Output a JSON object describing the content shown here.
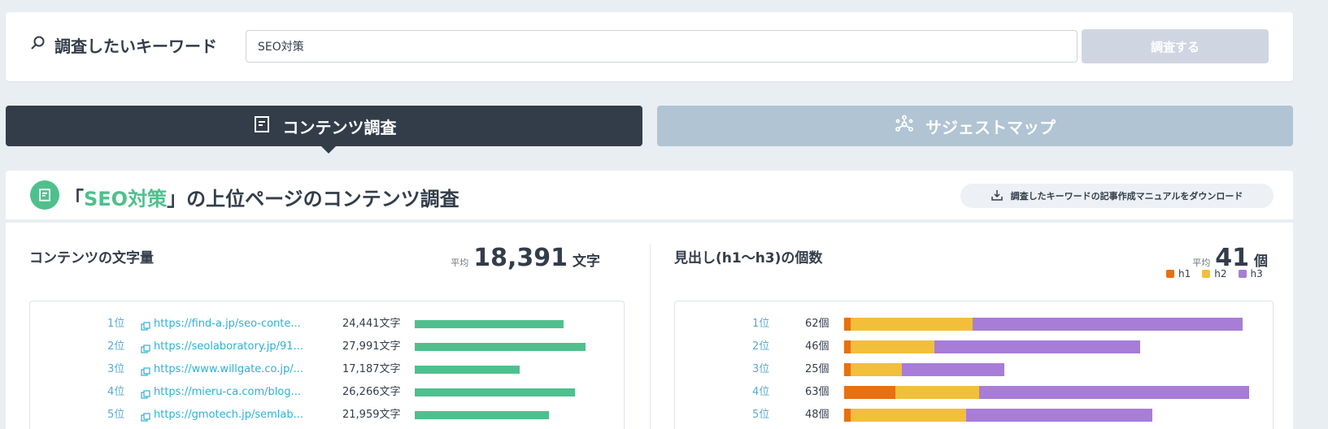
{
  "search": {
    "label": "調査したいキーワード",
    "value": "SEO対策",
    "button_label": "調査する"
  },
  "tabs": [
    {
      "label": "コンテンツ調査",
      "active": true
    },
    {
      "label": "サジェストマップ",
      "active": false
    }
  ],
  "main": {
    "title_open": "「",
    "title_keyword": "SEO対策",
    "title_rest": "」の上位ページのコンテンツ調査",
    "download_label": "調査したキーワードの記事作成マニュアルをダウンロード"
  },
  "word_count": {
    "title": "コンテンツの文字量",
    "avg_label": "平均",
    "avg_value": "18,391",
    "avg_unit": "文字",
    "rows": [
      {
        "rank": "1位",
        "url": "https://find-a.jp/seo-conte...",
        "count": "24,441文字"
      },
      {
        "rank": "2位",
        "url": "https://seolaboratory.jp/91...",
        "count": "27,991文字"
      },
      {
        "rank": "3位",
        "url": "https://www.willgate.co.jp/...",
        "count": "17,187文字"
      },
      {
        "rank": "4位",
        "url": "https://mieru-ca.com/blog...",
        "count": "26,266文字"
      },
      {
        "rank": "5位",
        "url": "https://gmotech.jp/semlab...",
        "count": "21,959文字"
      }
    ]
  },
  "headings": {
    "title": "見出し(h1〜h3)の個数",
    "avg_label": "平均",
    "avg_value": "41",
    "avg_unit": "個",
    "legend": [
      "h1",
      "h2",
      "h3"
    ],
    "rows": [
      {
        "rank": "1位",
        "count": "62個"
      },
      {
        "rank": "2位",
        "count": "46個"
      },
      {
        "rank": "3位",
        "count": "25個"
      },
      {
        "rank": "4位",
        "count": "63個"
      },
      {
        "rank": "5位",
        "count": "48個"
      }
    ]
  },
  "colors": {
    "accent": "#4fc08d",
    "dark": "#333d4a",
    "h1": "#e8700f",
    "h2": "#f2bf3b",
    "h3": "#a77dd8",
    "link": "#2bb1d6"
  },
  "chart_data": [
    {
      "type": "bar",
      "title": "コンテンツの文字量",
      "categories": [
        "1位",
        "2位",
        "3位",
        "4位",
        "5位"
      ],
      "values": [
        24441,
        27991,
        17187,
        26266,
        21959
      ],
      "xlim": [
        0,
        28000
      ]
    },
    {
      "type": "bar",
      "title": "見出し(h1〜h3)の個数",
      "categories": [
        "1位",
        "2位",
        "3位",
        "4位",
        "5位"
      ],
      "stacked": true,
      "series": [
        {
          "name": "h1",
          "values": [
            1,
            1,
            1,
            8,
            1
          ]
        },
        {
          "name": "h2",
          "values": [
            19,
            13,
            8,
            13,
            18
          ]
        },
        {
          "name": "h3",
          "values": [
            42,
            32,
            16,
            42,
            29
          ]
        }
      ],
      "xlim": [
        0,
        63
      ]
    }
  ]
}
